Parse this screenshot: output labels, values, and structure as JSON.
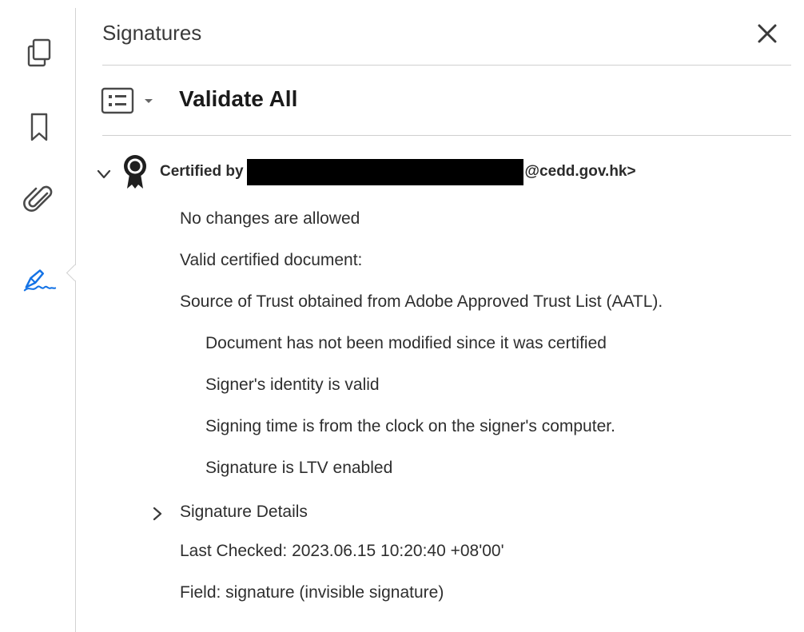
{
  "left_rail": {
    "items": [
      {
        "icon": "pages-icon"
      },
      {
        "icon": "bookmark-icon"
      },
      {
        "icon": "attachment-icon"
      },
      {
        "icon": "signature-pen-icon",
        "active": true,
        "color": "#1473e6"
      }
    ]
  },
  "panel": {
    "title": "Signatures",
    "close_icon": "close-icon",
    "validate_all_label": "Validate All",
    "certificate": {
      "prefix": "Certified by",
      "suffix": "@cedd.gov.hk>",
      "redacted": true,
      "lines": [
        {
          "text": "No changes are allowed",
          "level": 1
        },
        {
          "text": "Valid certified document:",
          "level": 1
        },
        {
          "text": "Source of Trust obtained from Adobe Approved Trust List (AATL).",
          "level": 1
        },
        {
          "text": "Document has not been modified since it was certified",
          "level": 2
        },
        {
          "text": "Signer's identity is valid",
          "level": 2
        },
        {
          "text": "Signing time is from the clock on the signer's computer.",
          "level": 2
        },
        {
          "text": "Signature is LTV enabled",
          "level": 2
        }
      ],
      "details_label": "Signature Details",
      "last_checked": "Last Checked: 2023.06.15 10:20:40 +08'00'",
      "field": "Field: signature (invisible signature)"
    }
  },
  "colors": {
    "accent": "#1473e6",
    "divider": "#cfcfcf",
    "text": "#2e2e2e"
  }
}
